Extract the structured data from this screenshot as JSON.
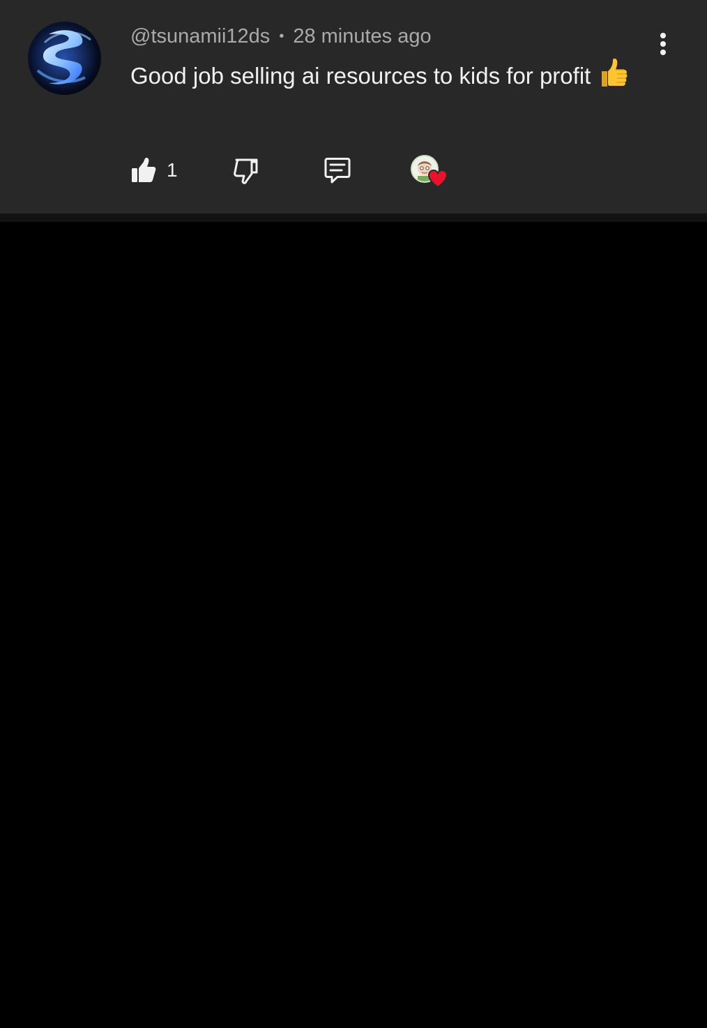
{
  "comment": {
    "username": "@tsunamii12ds",
    "separator": "•",
    "timestamp": "28 minutes ago",
    "text": "Good job selling ai resources to kids for profit",
    "emoji_icon": "thumbs-up-emoji"
  },
  "actions": {
    "like_count": "1",
    "like_icon": "thumb-up-icon",
    "dislike_icon": "thumb-down-icon",
    "reply_icon": "reply-comment-icon",
    "creator_heart_icon": "creator-heart-icon"
  },
  "menu": {
    "icon": "more-vertical-icon"
  },
  "colors": {
    "card_background": "#282828",
    "page_background": "#000000",
    "meta_text": "#aaaaaa",
    "primary_text": "#f1f1f1",
    "heart": "#e8132b"
  }
}
